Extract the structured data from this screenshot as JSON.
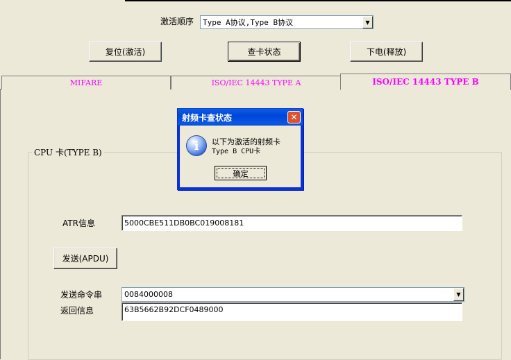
{
  "activation": {
    "label": "激活顺序",
    "selected": "Type A协议,Type B协议"
  },
  "buttons": {
    "reset": "复位(激活)",
    "check_status": "查卡状态",
    "power_off": "下电(释放)"
  },
  "tabs": [
    {
      "label": "MIFARE"
    },
    {
      "label": "ISO/IEC 14443 TYPE A"
    },
    {
      "label": "ISO/IEC 14443 TYPE B"
    }
  ],
  "group": {
    "title": "CPU 卡(TYPE B)"
  },
  "atr": {
    "label": "ATR信息",
    "value": "5000CBE511DB0BC019008181"
  },
  "send_apdu": "发送(APDU)",
  "command": {
    "label": "发送命令串",
    "value": "0084000008"
  },
  "response": {
    "label": "返回信息",
    "value": "63B5662B92DCF0489000"
  },
  "dialog": {
    "title": "射频卡查状态",
    "line1": "以下为激活的射频卡",
    "line2": "Type B CPU卡",
    "ok": "确定",
    "close_glyph": "✕",
    "icon_glyph": "i"
  },
  "colors": {
    "tab_text": "#ff00ff",
    "dialog_title": "#0a5fe4",
    "window_bg": "#ece9d8"
  },
  "icons": [
    "dropdown-arrow-icon",
    "info-icon",
    "close-icon"
  ]
}
